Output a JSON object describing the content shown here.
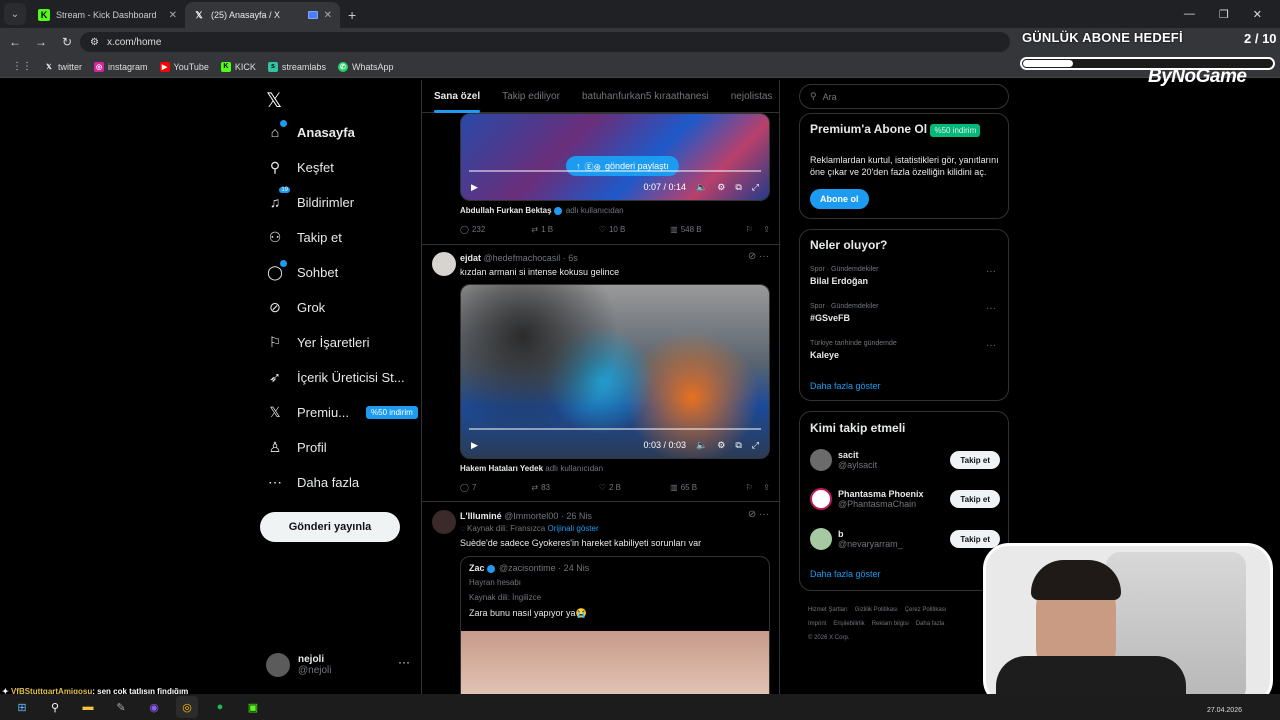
{
  "browser": {
    "tabs": [
      {
        "title": "Stream - Kick Dashboard",
        "active": false
      },
      {
        "title": "(25) Anasayfa / X",
        "active": true
      }
    ],
    "url": "x.com/home",
    "bookmarks": [
      "twitter",
      "instagram",
      "YouTube",
      "KICK",
      "streamlabs",
      "WhatsApp"
    ]
  },
  "overlay": {
    "goal_title": "GÜNLÜK ABONE HEDEFİ",
    "goal_count": "2 / 10",
    "goal_progress": 0.2,
    "brand": "ByNoGame"
  },
  "sidebar": {
    "items": [
      {
        "label": "Anasayfa",
        "icon": "home-icon"
      },
      {
        "label": "Keşfet",
        "icon": "search-icon"
      },
      {
        "label": "Bildirimler",
        "icon": "bell-icon"
      },
      {
        "label": "Takip et",
        "icon": "follow-icon"
      },
      {
        "label": "Sohbet",
        "icon": "chat-icon"
      },
      {
        "label": "Grok",
        "icon": "grok-icon"
      },
      {
        "label": "Yer İşaretleri",
        "icon": "bookmark-icon"
      },
      {
        "label": "İçerik Üreticisi St...",
        "icon": "rocket-icon"
      },
      {
        "label": "Premiu...",
        "icon": "x-icon"
      },
      {
        "label": "Profil",
        "icon": "profile-icon"
      },
      {
        "label": "Daha fazla",
        "icon": "more-icon"
      }
    ],
    "premium_badge": "%50 indirim",
    "post_button": "Gönderi yayınla",
    "user": {
      "name": "nejoli",
      "handle": "@nejoli"
    }
  },
  "feed": {
    "tabs": [
      "Sana özel",
      "Takip ediliyor",
      "batuhanfurkan5 kıraathanesi",
      "nejolistas"
    ],
    "post1": {
      "share_label": "gönderi paylaştı",
      "time": "0:07 / 0:14",
      "attribution_name": "Abdullah Furkan Bektaş",
      "attribution_suffix": "adlı kullanıcıdan",
      "replies": "232",
      "reposts": "1 B",
      "likes": "10 B",
      "views": "548 B"
    },
    "post2": {
      "name": "ejdat",
      "handle": "@hedefmachocasil · 6s",
      "text": "kızdan armani si intense kokusu gelince",
      "time": "0:03 / 0:03",
      "attribution_name": "Hakem Hataları Yedek",
      "attribution_suffix": "adlı kullanıcıdan",
      "replies": "7",
      "reposts": "83",
      "likes": "2 B",
      "views": "65 B"
    },
    "post3": {
      "name": "L'Illuminé",
      "handle": "@Immortel00 · 26 Nis",
      "lang": "Kaynak dili: Fransızca",
      "show_original": "Orijinali göster",
      "text": "Suède'de sadece Gyokeres'in hareket kabiliyeti sorunları var",
      "quote": {
        "name": "Zac",
        "handle": "@zacisontime · 24 Nis",
        "fan": "Hayran hesabı",
        "lang": "Kaynak dili: İngilizce",
        "text": "Zara bunu nasıl yapıyor ya😭"
      }
    }
  },
  "right": {
    "search_placeholder": "Ara",
    "premium": {
      "title": "Premium'a Abone Ol",
      "badge": "%50 indirim",
      "text": "Reklamlardan kurtul, istatistikleri gör, yanıtlarını öne çıkar ve 20'den fazla özelliğin kilidini aç.",
      "button": "Abone ol"
    },
    "trends": {
      "title": "Neler oluyor?",
      "items": [
        {
          "context": "Spor · Gündemdekiler",
          "name": "Bilal Erdoğan"
        },
        {
          "context": "Spor · Gündemdekiler",
          "name": "#GSveFB"
        },
        {
          "context": "Türkiye tarihinde gündemde",
          "name": "Kaleye"
        }
      ],
      "more": "Daha fazla göster"
    },
    "who": {
      "title": "Kimi takip etmeli",
      "items": [
        {
          "name": "sacit",
          "handle": "@aylsacit",
          "button": "Takip et"
        },
        {
          "name": "Phantasma Phoenix",
          "handle": "@PhantasmaChain",
          "button": "Takip et"
        },
        {
          "name": "b",
          "handle": "@nevaryarram_",
          "button": "Takip et"
        }
      ],
      "more": "Daha fazla göster"
    },
    "footer": [
      "Hizmet Şartları",
      "Gizlilik Politikası",
      "Çerez Politikası",
      "Imprint",
      "Erişilebilirlik",
      "Reklam bilgisi",
      "Daha fazla",
      "© 2026 X Corp."
    ]
  },
  "stream_chat": {
    "user": "VfBStuttgartAmigosu",
    "message": ": sen çok tatlısın findığım"
  },
  "taskbar": {
    "date": "27.04.2026"
  }
}
